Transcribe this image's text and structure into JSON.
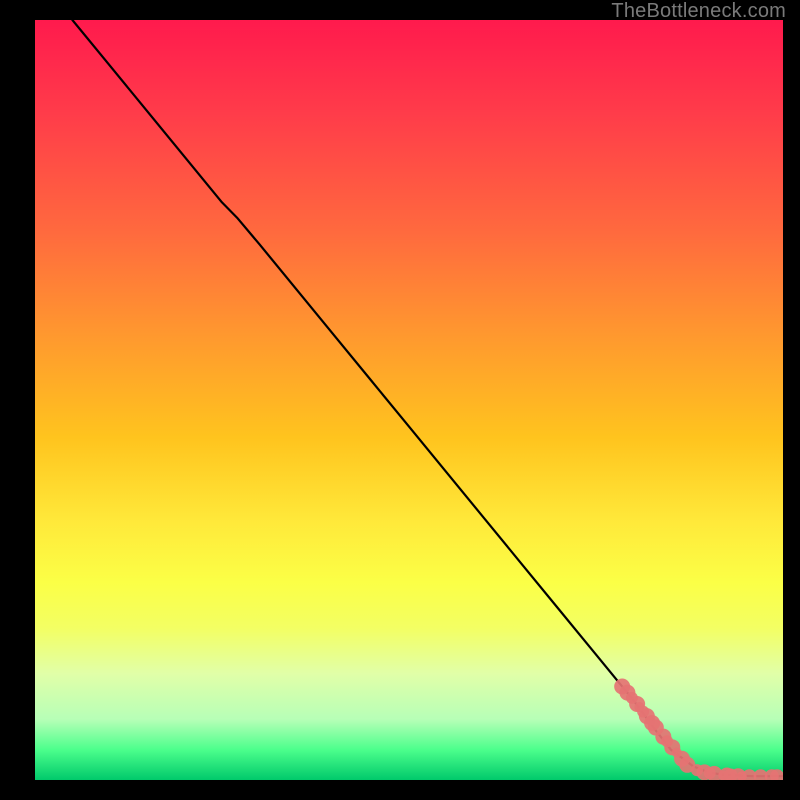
{
  "watermark": "TheBottleneck.com",
  "chart_data": {
    "type": "line",
    "title": "",
    "xlabel": "",
    "ylabel": "",
    "xlim": [
      0,
      100
    ],
    "ylim": [
      0,
      100
    ],
    "grid": false,
    "legend": false,
    "series": [
      {
        "name": "curve",
        "x": [
          5,
          10,
          15,
          20,
          25,
          27,
          30,
          35,
          40,
          45,
          50,
          55,
          60,
          65,
          70,
          75,
          80,
          83,
          85,
          88,
          90,
          92,
          94,
          96,
          98,
          100
        ],
        "y": [
          100,
          94,
          88,
          82,
          76,
          74,
          70.5,
          64.5,
          58.5,
          52.5,
          46.5,
          40.5,
          34.5,
          28.5,
          22.5,
          16.5,
          10.5,
          6.5,
          4.0,
          1.8,
          1.0,
          0.7,
          0.6,
          0.5,
          0.5,
          0.5
        ]
      }
    ],
    "markers": [
      {
        "name": "points",
        "color": "#e57373",
        "x": [
          78.5,
          79.2,
          79.8,
          80.5,
          80.8,
          81.3,
          81.8,
          82.3,
          82.5,
          83.0,
          84.0,
          84.5,
          85.2,
          85.8,
          86.5,
          87.2,
          88.5,
          89.5,
          90.2,
          90.8,
          92.0,
          92.5,
          93.0,
          94.0,
          94.5,
          95.5,
          97.0,
          98.5,
          99.2
        ],
        "y": [
          12.3,
          11.5,
          10.8,
          10.0,
          9.6,
          9.0,
          8.4,
          7.8,
          7.5,
          6.9,
          5.7,
          5.1,
          4.3,
          3.6,
          2.8,
          2.0,
          1.3,
          1.0,
          0.9,
          0.8,
          0.6,
          0.6,
          0.6,
          0.5,
          0.5,
          0.5,
          0.5,
          0.5,
          0.5
        ],
        "r": [
          8,
          8,
          6,
          8,
          5,
          6,
          8,
          5,
          8,
          8,
          8,
          6,
          8,
          5,
          8,
          8,
          6,
          8,
          6,
          8,
          5,
          8,
          7,
          8,
          5,
          7,
          7,
          7,
          7
        ]
      }
    ]
  }
}
